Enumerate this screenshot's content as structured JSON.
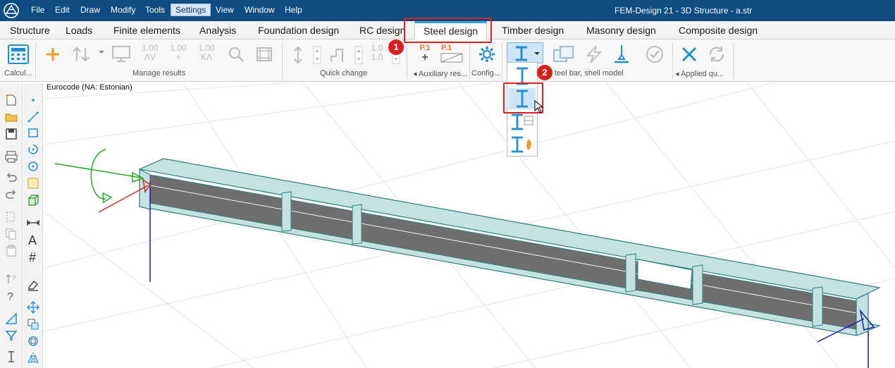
{
  "app": {
    "window_title": "FEM-Design 21 - 3D Structure - a.str"
  },
  "menu": [
    "File",
    "Edit",
    "Draw",
    "Modify",
    "Tools",
    "Settings",
    "View",
    "Window",
    "Help"
  ],
  "menu_active": "Settings",
  "tabs": [
    "Structure",
    "Loads",
    "Finite elements",
    "Analysis",
    "Foundation design",
    "RC design",
    "Steel design",
    "Timber design",
    "Masonry design",
    "Composite design"
  ],
  "active_tab": "Steel design",
  "ribbon": {
    "groups": {
      "calc": "Calcul...",
      "manage_results": "Manage results",
      "quick_change": "Quick change",
      "auxiliary": "Auxiliary res...",
      "config": "Config...",
      "steel_bar": "teel bar, shell model",
      "applied": "Applied qu..."
    },
    "number_labels": {
      "a_top": "1.00",
      "a_bot": "ΛV",
      "b_top": "1.00",
      "b_bot": "+",
      "c_top": "1.00",
      "c_bot": "KΛ",
      "q_top": "1.0",
      "q_bot": "1.0",
      "p1": "P.1",
      "p1b": "P.1"
    }
  },
  "callouts": {
    "first": "1",
    "second": "2"
  },
  "viewport": {
    "code_label": "Eurocode (NA: Estonian)"
  },
  "colors": {
    "title_bar": "#0f4c81",
    "accent_tab": "#3aa0d8",
    "highlight": "#e02020",
    "icon_blue": "#1f8fd0",
    "icon_orange": "#f39a2b"
  }
}
